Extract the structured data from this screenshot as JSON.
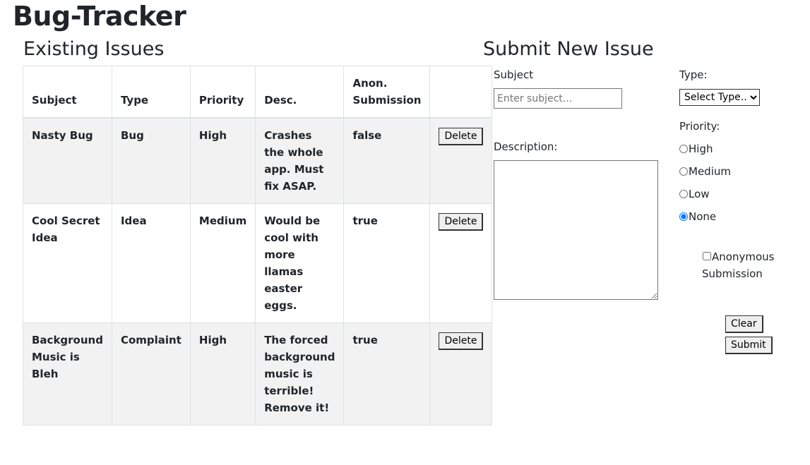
{
  "app": {
    "title": "Bug-Tracker"
  },
  "issues_section": {
    "title": "Existing Issues",
    "columns": [
      "Subject",
      "Type",
      "Priority",
      "Desc.",
      "Anon. Submission",
      ""
    ],
    "delete_label": "Delete",
    "rows": [
      {
        "subject": "Nasty Bug",
        "type": "Bug",
        "priority": "High",
        "desc": "Crashes the whole app. Must fix ASAP.",
        "anon": "false"
      },
      {
        "subject": "Cool Secret Idea",
        "type": "Idea",
        "priority": "Medium",
        "desc": "Would be cool with more llamas easter eggs.",
        "anon": "true"
      },
      {
        "subject": "Background Music is Bleh",
        "type": "Complaint",
        "priority": "High",
        "desc": "The forced background music is terrible! Remove it!",
        "anon": "true"
      }
    ]
  },
  "form": {
    "title": "Submit New Issue",
    "subject_label": "Subject",
    "subject_placeholder": "Enter subject...",
    "subject_value": "",
    "description_label": "Description:",
    "type_label": "Type:",
    "type_selected": "Select Type...",
    "priority_label": "Priority:",
    "priority_options": [
      "High",
      "Medium",
      "Low",
      "None"
    ],
    "priority_selected": "None",
    "anon_label": "Anonymous Submission",
    "anon_checked": false,
    "clear_label": "Clear",
    "submit_label": "Submit"
  },
  "colors": {
    "text": "#212529",
    "stripe": "#f2f2f2",
    "border": "#dee2e6",
    "radio_accent": "#0075ff"
  }
}
